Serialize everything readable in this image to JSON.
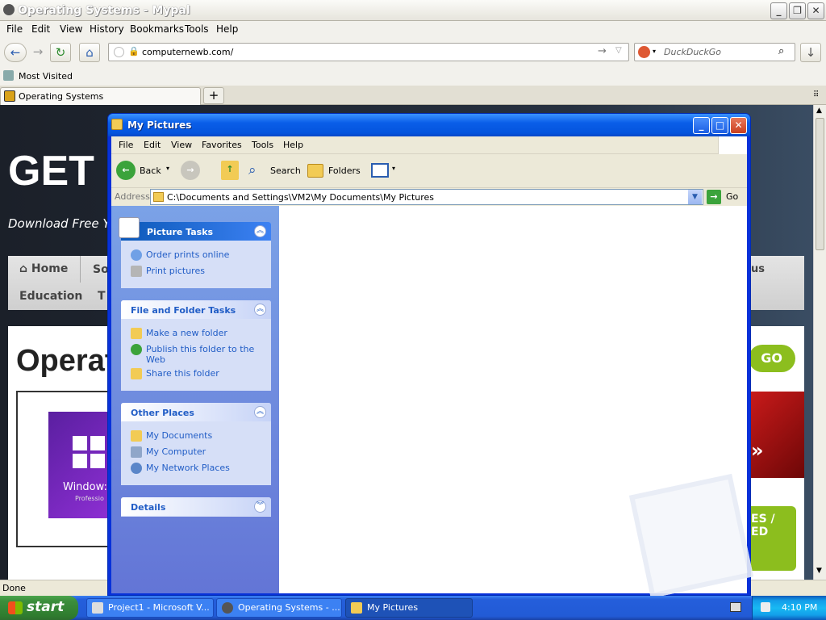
{
  "browser": {
    "title": "Operating Systems - Mypal",
    "menu": [
      "File",
      "Edit",
      "View",
      "History",
      "Bookmarks",
      "Tools",
      "Help"
    ],
    "url": "computernewb.com/",
    "search_placeholder": "DuckDuckGo",
    "bookmark": "Most Visited",
    "tab": "Operating Systems",
    "status": "Done"
  },
  "webpage": {
    "logo": "GET",
    "tagline": "Download Free Yo",
    "nav": [
      "Home",
      "So",
      "Education",
      "T",
      "us"
    ],
    "heading": "Operat",
    "go": "GO",
    "product_name": "Window:",
    "product_sub": "Professio",
    "promo": "ES /\nED"
  },
  "explorer": {
    "title": "My Pictures",
    "menu": [
      "File",
      "Edit",
      "View",
      "Favorites",
      "Tools",
      "Help"
    ],
    "toolbar": {
      "back": "Back",
      "search": "Search",
      "folders": "Folders"
    },
    "address_label": "Address",
    "address": "C:\\Documents and Settings\\VM2\\My Documents\\My Pictures",
    "go": "Go",
    "panels": {
      "picture_tasks": {
        "title": "Picture Tasks",
        "items": [
          "Order prints online",
          "Print pictures"
        ]
      },
      "file_tasks": {
        "title": "File and Folder Tasks",
        "items": [
          "Make a new folder",
          "Publish this folder to the Web",
          "Share this folder"
        ]
      },
      "other_places": {
        "title": "Other Places",
        "items": [
          "My Documents",
          "My Computer",
          "My Network Places"
        ]
      },
      "details": {
        "title": "Details"
      }
    }
  },
  "taskbar": {
    "start": "start",
    "tasks": [
      "Project1 - Microsoft V...",
      "Operating Systems - ...",
      "My Pictures"
    ],
    "clock": "4:10 PM"
  }
}
